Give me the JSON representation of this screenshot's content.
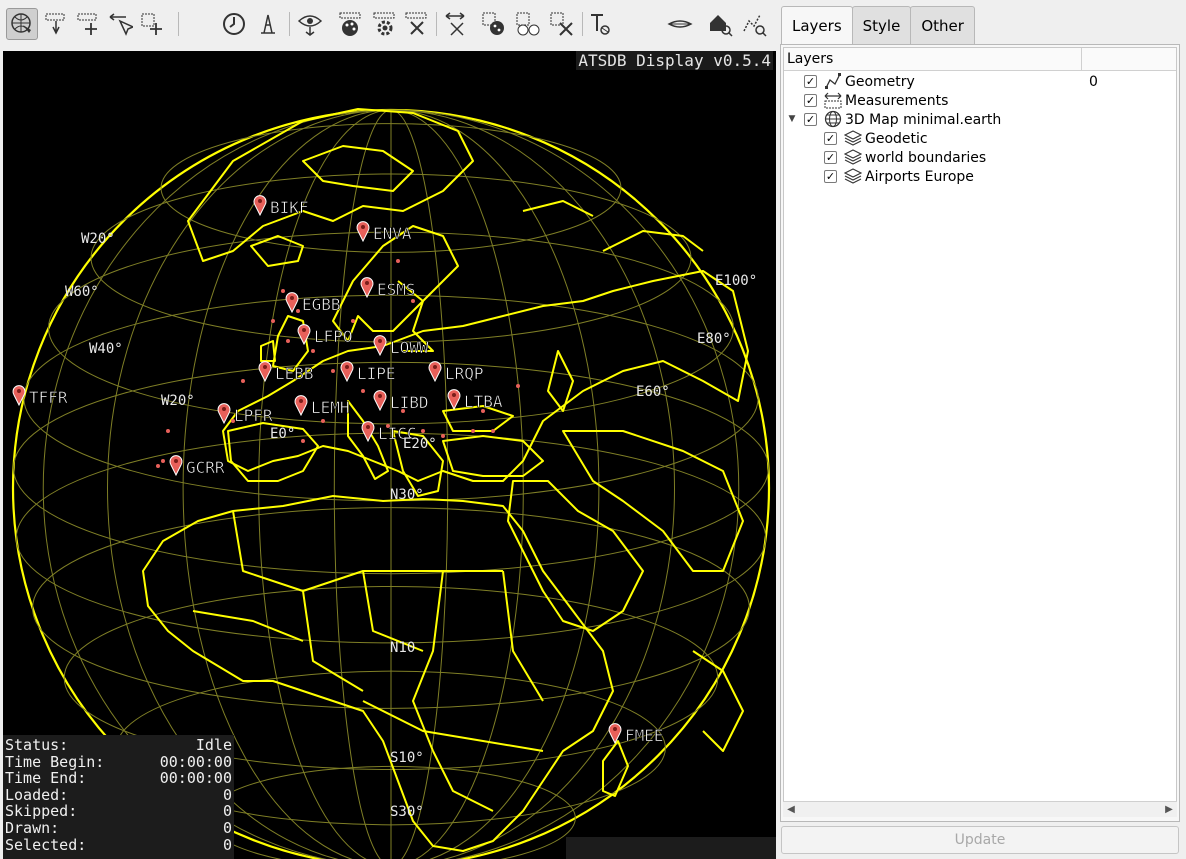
{
  "toolbar": {
    "tools": [
      "navigate-tool",
      "select-point-tool",
      "add-selection-tool",
      "select-arrow-tool",
      "add-point-tool",
      "time-tool",
      "distance-tool",
      "view-export-tool",
      "style-palette-tool",
      "settings-tool",
      "clear-tool",
      "reset-tool",
      "color-select-tool",
      "color-add-tool",
      "color-remove-tool",
      "text-tool",
      "horizon-tool",
      "home-tool",
      "track-tool"
    ]
  },
  "map": {
    "title": "ATSDB Display v0.5.4",
    "grid_labels": [
      "W20°",
      "W60°",
      "W40°",
      "W20°",
      "E0°",
      "E20°",
      "N30°",
      "N10",
      "S10°",
      "S30°",
      "E100°",
      "E80°",
      "E60°"
    ],
    "airports": [
      "BIKF",
      "ENVA",
      "ESMS",
      "EGBB",
      "LFPO",
      "LOWW",
      "LEBB",
      "LIPE",
      "LRQP",
      "TFFR",
      "LPFR",
      "LEMH",
      "LIBD",
      "LTBA",
      "LICC",
      "GCRR",
      "FMEE"
    ],
    "status": [
      {
        "label": "Status:",
        "value": "Idle"
      },
      {
        "label": "Time Begin:",
        "value": "00:00:00"
      },
      {
        "label": "Time End:",
        "value": "00:00:00"
      },
      {
        "label": "Loaded:",
        "value": "0"
      },
      {
        "label": "Skipped:",
        "value": "0"
      },
      {
        "label": "Drawn:",
        "value": "0"
      },
      {
        "label": "Selected:",
        "value": "0"
      }
    ],
    "colors": {
      "boundary": "#ffff00",
      "grid": "#8a8a2a",
      "marker": "#e8605a"
    }
  },
  "tabs": [
    {
      "label": "Layers",
      "active": true
    },
    {
      "label": "Style",
      "active": false
    },
    {
      "label": "Other",
      "active": false
    }
  ],
  "layers": {
    "header": "Layers",
    "rows": [
      {
        "label": "Geometry",
        "value": "0",
        "checked": true,
        "icon": "geometry-icon",
        "level": 0
      },
      {
        "label": "Measurements",
        "value": "",
        "checked": true,
        "icon": "measure-icon",
        "level": 0
      },
      {
        "label": "3D Map minimal.earth",
        "value": "",
        "checked": true,
        "icon": "globe-icon",
        "level": 0,
        "expanded": true
      },
      {
        "label": "Geodetic",
        "value": "",
        "checked": true,
        "icon": "layers-icon",
        "level": 1
      },
      {
        "label": "world boundaries",
        "value": "",
        "checked": true,
        "icon": "layers-icon",
        "level": 1
      },
      {
        "label": "Airports Europe",
        "value": "",
        "checked": true,
        "icon": "layers-icon",
        "level": 1
      }
    ]
  },
  "update_label": "Update"
}
